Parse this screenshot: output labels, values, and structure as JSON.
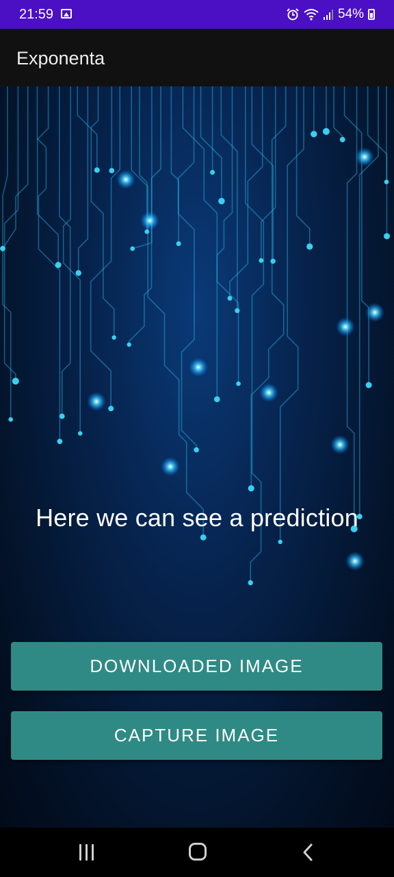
{
  "status_bar": {
    "time": "21:59",
    "battery": "54%",
    "icons": [
      "gallery-icon",
      "alarm-icon",
      "wifi-icon",
      "signal-icon",
      "battery-icon"
    ],
    "background": "#4b10c4"
  },
  "app_bar": {
    "title": "Exponenta",
    "background": "#111111"
  },
  "main": {
    "prediction_text": "Here we can see a prediction",
    "buttons": {
      "downloaded": "DOWNLOADED IMAGE",
      "capture": "CAPTURE IMAGE"
    },
    "button_color": "#2f8a85"
  },
  "nav_bar": {
    "icons": [
      "recent-apps-icon",
      "home-icon",
      "back-icon"
    ]
  }
}
